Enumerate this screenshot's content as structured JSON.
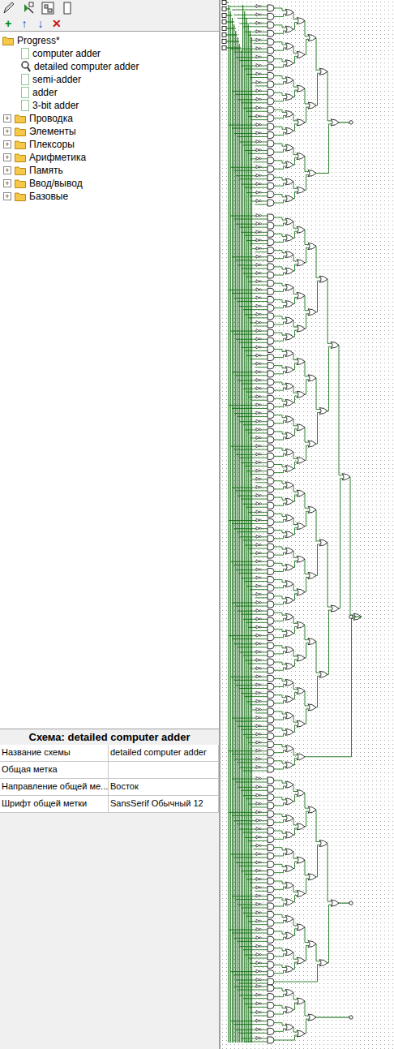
{
  "window": {
    "title": "detailed computer adder"
  },
  "toolbar": {
    "tools": [
      "edit",
      "simulate",
      "layout",
      "appearance"
    ],
    "actions": [
      {
        "symbol": "+",
        "color": "#0a8a0a"
      },
      {
        "symbol": "↑",
        "color": "#1040d0"
      },
      {
        "symbol": "↓",
        "color": "#1040d0"
      },
      {
        "symbol": "✕",
        "color": "#d01010"
      }
    ]
  },
  "project": {
    "label": "Progress*",
    "expanded": true,
    "circuits": [
      {
        "label": "computer adder",
        "selected": false
      },
      {
        "label": "detailed computer adder",
        "selected": true
      },
      {
        "label": "semi-adder",
        "selected": false
      },
      {
        "label": "adder",
        "selected": false
      },
      {
        "label": "3-bit adder",
        "selected": false
      }
    ],
    "libraries": [
      {
        "label": "Проводка",
        "expanded": false
      },
      {
        "label": "Элементы",
        "expanded": false
      },
      {
        "label": "Плексоры",
        "expanded": false
      },
      {
        "label": "Арифметика",
        "expanded": false
      },
      {
        "label": "Память",
        "expanded": false
      },
      {
        "label": "Ввод/вывод",
        "expanded": false
      },
      {
        "label": "Базовые",
        "expanded": false
      }
    ]
  },
  "properties": {
    "title": "Схема: detailed computer adder",
    "rows": [
      {
        "name": "Название схемы",
        "value": "detailed computer adder"
      },
      {
        "name": "Общая метка",
        "value": ""
      },
      {
        "name": "Направление общей ме...",
        "value": "Восток"
      },
      {
        "name": "Шрифт общей метки",
        "value": "SansSerif Обычный 12"
      }
    ]
  },
  "circuit": {
    "input_pins": 8,
    "sections": [
      {
        "and_gates": 24
      },
      {
        "and_gates": 68
      },
      {
        "and_gates": 25
      },
      {
        "and_gates": 7
      }
    ]
  }
}
